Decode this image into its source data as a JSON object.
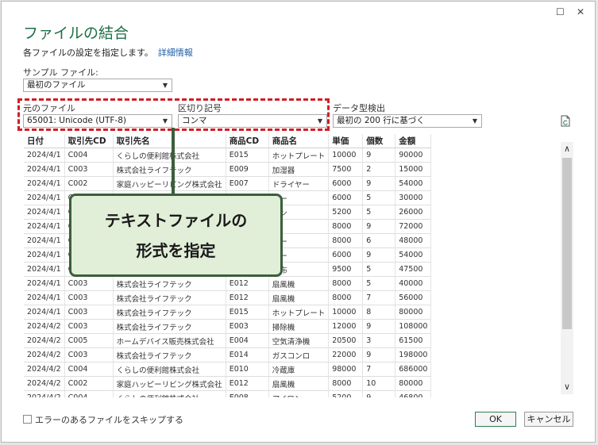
{
  "window": {
    "maximize_glyph": "☐",
    "close_glyph": "✕"
  },
  "header": {
    "title": "ファイルの結合",
    "description": "各ファイルの設定を指定します。",
    "details_link": "詳細情報"
  },
  "sample_file": {
    "label": "サンプル ファイル:",
    "value": "最初のファイル"
  },
  "file_origin": {
    "label": "元のファイル",
    "value": "65001: Unicode (UTF-8)"
  },
  "delimiter": {
    "label": "区切り記号",
    "value": "コンマ"
  },
  "data_type_detection": {
    "label": "データ型検出",
    "value": "最初の 200 行に基づく"
  },
  "table": {
    "headers": [
      "日付",
      "取引先CD",
      "取引先名",
      "商品CD",
      "商品名",
      "単価",
      "個数",
      "金額"
    ],
    "rows": [
      [
        "2024/4/1",
        "C004",
        "くらしの便利館株式会社",
        "E015",
        "ホットプレート",
        "10000",
        "9",
        "90000"
      ],
      [
        "2024/4/1",
        "C003",
        "株式会社ライフテック",
        "E009",
        "加湿器",
        "7500",
        "2",
        "15000"
      ],
      [
        "2024/4/1",
        "C002",
        "家庭ハッピーリビング株式会社",
        "E007",
        "ドライヤー",
        "6000",
        "9",
        "54000"
      ],
      [
        "2024/4/1",
        "C",
        "",
        "",
        "ヤー",
        "6000",
        "5",
        "30000"
      ],
      [
        "2024/4/1",
        "C",
        "",
        "",
        "コン",
        "5200",
        "5",
        "26000"
      ],
      [
        "2024/4/1",
        "C",
        "",
        "",
        "機",
        "8000",
        "9",
        "72000"
      ],
      [
        "2024/4/1",
        "C",
        "",
        "",
        "ヤー",
        "8000",
        "6",
        "48000"
      ],
      [
        "2024/4/1",
        "C",
        "",
        "",
        "ヤー",
        "6000",
        "9",
        "54000"
      ],
      [
        "2024/4/1",
        "C",
        "",
        "",
        "毛布",
        "9500",
        "5",
        "47500"
      ],
      [
        "2024/4/1",
        "C003",
        "株式会社ライフテック",
        "E012",
        "扇風機",
        "8000",
        "5",
        "40000"
      ],
      [
        "2024/4/1",
        "C003",
        "株式会社ライフテック",
        "E012",
        "扇風機",
        "8000",
        "7",
        "56000"
      ],
      [
        "2024/4/1",
        "C003",
        "株式会社ライフテック",
        "E015",
        "ホットプレート",
        "10000",
        "8",
        "80000"
      ],
      [
        "2024/4/2",
        "C003",
        "株式会社ライフテック",
        "E003",
        "掃除機",
        "12000",
        "9",
        "108000"
      ],
      [
        "2024/4/2",
        "C005",
        "ホームデバイス販売株式会社",
        "E004",
        "空気清浄機",
        "20500",
        "3",
        "61500"
      ],
      [
        "2024/4/2",
        "C003",
        "株式会社ライフテック",
        "E014",
        "ガスコンロ",
        "22000",
        "9",
        "198000"
      ],
      [
        "2024/4/2",
        "C004",
        "くらしの便利館株式会社",
        "E010",
        "冷蔵庫",
        "98000",
        "7",
        "686000"
      ],
      [
        "2024/4/2",
        "C002",
        "家庭ハッピーリビング株式会社",
        "E012",
        "扇風機",
        "8000",
        "10",
        "80000"
      ],
      [
        "2024/4/2",
        "C004",
        "くらしの便利館株式会社",
        "E008",
        "アイロン",
        "5200",
        "9",
        "46800"
      ]
    ]
  },
  "callout": {
    "line1": "テキストファイルの",
    "line2": "形式を指定"
  },
  "footer": {
    "skip_label": "エラーのあるファイルをスキップする",
    "ok_label": "OK",
    "cancel_label": "キャンセル"
  },
  "colors": {
    "title": "#1e6e46",
    "link": "#1f5fa8",
    "highlight_dash": "#d11f26",
    "callout_bg": "#e1eed8"
  }
}
